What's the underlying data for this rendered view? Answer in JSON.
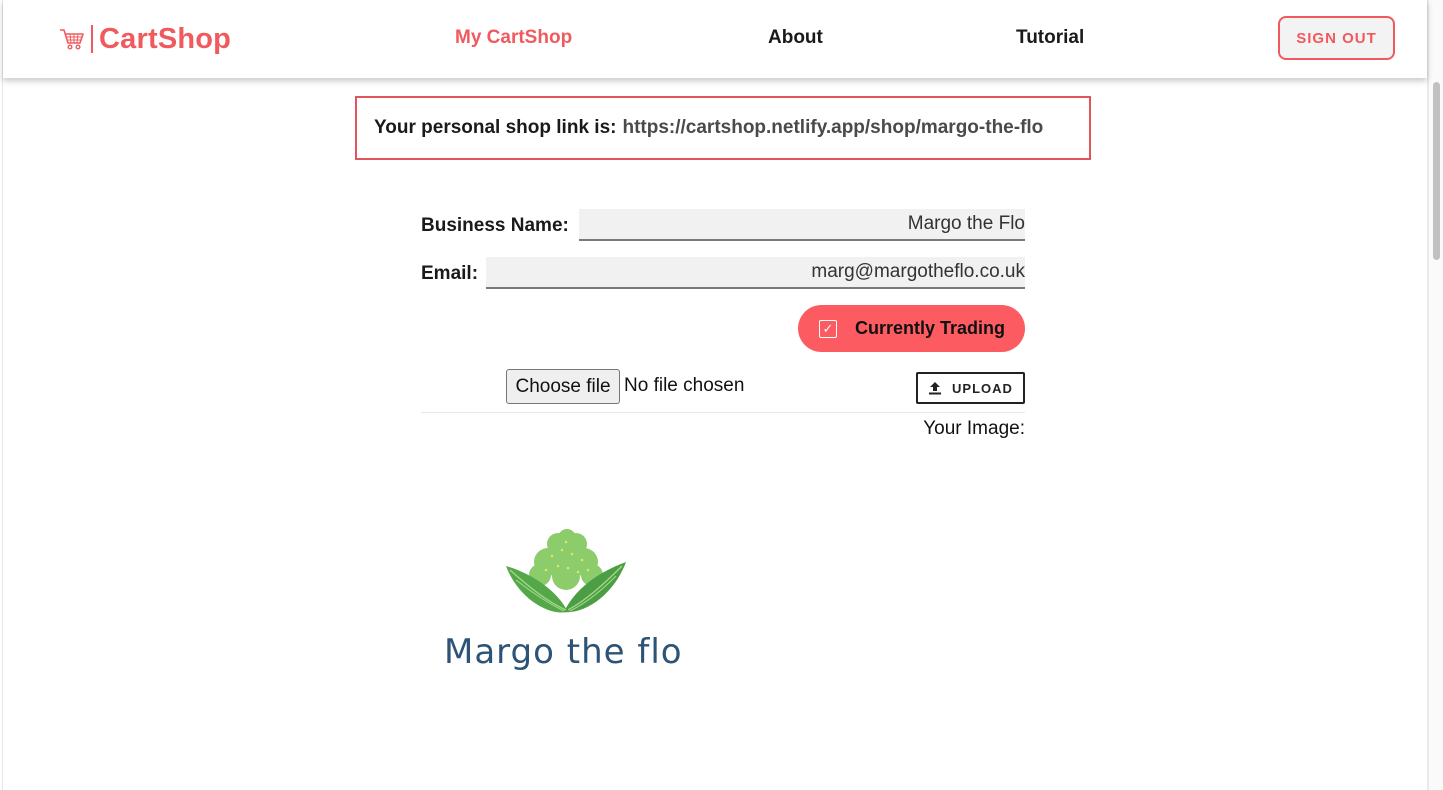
{
  "navbar": {
    "brand": "CartShop",
    "brand_icon": "shopping-cart-icon",
    "links": [
      {
        "label": "My CartShop",
        "active": true
      },
      {
        "label": "About",
        "active": false
      },
      {
        "label": "Tutorial",
        "active": false
      }
    ],
    "signout_label": "SIGN OUT"
  },
  "shop_link": {
    "prefix": "Your personal shop link is:",
    "url": "https://cartshop.netlify.app/shop/margo-the-flo"
  },
  "form": {
    "business_name_label": "Business Name:",
    "business_name_value": "Margo the Flo",
    "email_label": "Email:",
    "email_value": "marg@margotheflo.co.uk",
    "trading_label": "Currently Trading",
    "trading_checked": true,
    "choose_file_label": "Choose file",
    "no_file_label": "No file chosen",
    "upload_label": "UPLOAD",
    "your_image_label": "Your Image:"
  },
  "image": {
    "logo_text": "Margo the flo"
  },
  "colors": {
    "accent": "#f05a5e",
    "trading_button": "#fc5c61",
    "logo_text": "#2d5476"
  }
}
